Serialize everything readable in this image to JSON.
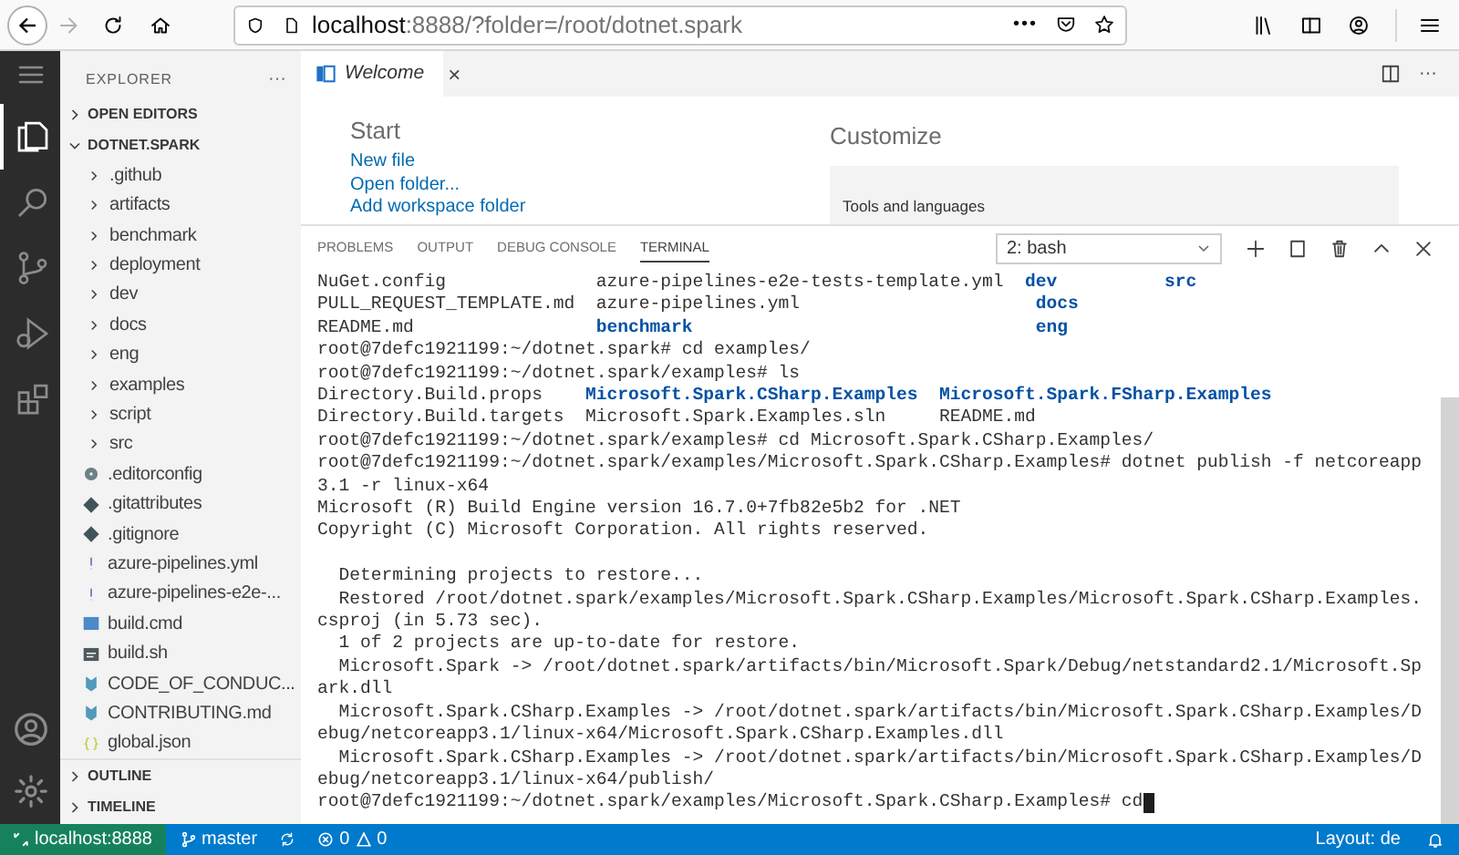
{
  "browser": {
    "url_host": "localhost",
    "url_path": ":8888/?folder=/root/dotnet.spark",
    "more": "•••",
    "forward_disabled": true
  },
  "activity_bar": [
    {
      "selected": true
    },
    {
      "selected": false
    },
    {
      "selected": false
    },
    {
      "selected": false
    },
    {
      "selected": false
    }
  ],
  "sidebar": {
    "title": "EXPLORER",
    "more": "···",
    "sections": [
      {
        "label": "OPEN EDITORS",
        "expanded": false
      },
      {
        "label": "DOTNET.SPARK",
        "expanded": true
      }
    ],
    "items": [
      {
        "kind": "folder",
        "label": ".github"
      },
      {
        "kind": "folder",
        "label": "artifacts"
      },
      {
        "kind": "folder",
        "label": "benchmark"
      },
      {
        "kind": "folder",
        "label": "deployment"
      },
      {
        "kind": "folder",
        "label": "dev"
      },
      {
        "kind": "folder",
        "label": "docs"
      },
      {
        "kind": "folder",
        "label": "eng"
      },
      {
        "kind": "folder",
        "label": "examples"
      },
      {
        "kind": "folder",
        "label": "script"
      },
      {
        "kind": "folder",
        "label": "src"
      },
      {
        "kind": "config",
        "label": ".editorconfig"
      },
      {
        "kind": "git",
        "label": ".gitattributes"
      },
      {
        "kind": "git",
        "label": ".gitignore"
      },
      {
        "kind": "yaml",
        "label": "azure-pipelines.yml"
      },
      {
        "kind": "yaml",
        "label": "azure-pipelines-e2e-..."
      },
      {
        "kind": "cmd",
        "label": "build.cmd"
      },
      {
        "kind": "shell",
        "label": "build.sh"
      },
      {
        "kind": "markdown",
        "label": "CODE_OF_CONDUC..."
      },
      {
        "kind": "markdown",
        "label": "CONTRIBUTING.md"
      },
      {
        "kind": "json",
        "label": "global.json"
      }
    ],
    "bottom_sections": [
      {
        "label": "OUTLINE",
        "expanded": false
      },
      {
        "label": "TIMELINE",
        "expanded": false
      }
    ]
  },
  "editor": {
    "tabs": [
      {
        "label": "Welcome",
        "selected": true,
        "close": "×"
      }
    ],
    "more": "···",
    "welcome": {
      "start_title": "Start",
      "start_links": [
        "New file",
        "Open folder...",
        "Add workspace folder"
      ],
      "customize_title": "Customize",
      "card_title": "Tools and languages"
    }
  },
  "panel": {
    "tabs": [
      {
        "label": "PROBLEMS",
        "selected": false
      },
      {
        "label": "OUTPUT",
        "selected": false
      },
      {
        "label": "DEBUG CONSOLE",
        "selected": false
      },
      {
        "label": "TERMINAL",
        "selected": true
      }
    ],
    "terminal_select": "2: bash",
    "lines": [
      {
        "kind": "text",
        "segments": [
          {
            "text": "NuGet.config              azure-pipelines-e2e-tests-template.yml  ",
            "dir": false
          },
          {
            "text": "dev          ",
            "dir": true
          },
          {
            "text": "src",
            "dir": true
          }
        ]
      },
      {
        "kind": "text",
        "segments": [
          {
            "text": "PULL_REQUEST_TEMPLATE.md  azure-pipelines.yml                      ",
            "dir": false
          },
          {
            "text": "docs",
            "dir": true
          }
        ]
      },
      {
        "kind": "text",
        "segments": [
          {
            "text": "README.md                 ",
            "dir": false
          },
          {
            "text": "benchmark                                ",
            "dir": true
          },
          {
            "text": "eng",
            "dir": true
          }
        ]
      },
      {
        "kind": "text",
        "segments": [
          {
            "text": "root@7defc1921199:~/dotnet.spark# cd examples/",
            "dir": false
          }
        ]
      },
      {
        "kind": "text",
        "segments": [
          {
            "text": "root@7defc1921199:~/dotnet.spark/examples# ls",
            "dir": false
          }
        ]
      },
      {
        "kind": "text",
        "segments": [
          {
            "text": "Directory.Build.props    ",
            "dir": false
          },
          {
            "text": "Microsoft.Spark.CSharp.Examples  ",
            "dir": true
          },
          {
            "text": "Microsoft.Spark.FSharp.Examples",
            "dir": true
          }
        ]
      },
      {
        "kind": "text",
        "segments": [
          {
            "text": "Directory.Build.targets  Microsoft.Spark.Examples.sln     README.md",
            "dir": false
          }
        ]
      },
      {
        "kind": "text",
        "segments": [
          {
            "text": "root@7defc1921199:~/dotnet.spark/examples# cd Microsoft.Spark.CSharp.Examples/",
            "dir": false
          }
        ]
      },
      {
        "kind": "text",
        "segments": [
          {
            "text": "root@7defc1921199:~/dotnet.spark/examples/Microsoft.Spark.CSharp.Examples# dotnet publish -f netcoreapp",
            "dir": false
          }
        ]
      },
      {
        "kind": "text",
        "segments": [
          {
            "text": "3.1 -r linux-x64",
            "dir": false
          }
        ]
      },
      {
        "kind": "text",
        "segments": [
          {
            "text": "Microsoft (R) Build Engine version 16.7.0+7fb82e5b2 for .NET",
            "dir": false
          }
        ]
      },
      {
        "kind": "text",
        "segments": [
          {
            "text": "Copyright (C) Microsoft Corporation. All rights reserved.",
            "dir": false
          }
        ]
      },
      {
        "kind": "blank"
      },
      {
        "kind": "text",
        "segments": [
          {
            "text": "  Determining projects to restore...",
            "dir": false
          }
        ]
      },
      {
        "kind": "text",
        "segments": [
          {
            "text": "  Restored /root/dotnet.spark/examples/Microsoft.Spark.CSharp.Examples/Microsoft.Spark.CSharp.Examples.",
            "dir": false
          }
        ]
      },
      {
        "kind": "text",
        "segments": [
          {
            "text": "csproj (in 5.73 sec).",
            "dir": false
          }
        ]
      },
      {
        "kind": "text",
        "segments": [
          {
            "text": "  1 of 2 projects are up-to-date for restore.",
            "dir": false
          }
        ]
      },
      {
        "kind": "text",
        "segments": [
          {
            "text": "  Microsoft.Spark -> /root/dotnet.spark/artifacts/bin/Microsoft.Spark/Debug/netstandard2.1/Microsoft.Sp",
            "dir": false
          }
        ]
      },
      {
        "kind": "text",
        "segments": [
          {
            "text": "ark.dll",
            "dir": false
          }
        ]
      },
      {
        "kind": "text",
        "segments": [
          {
            "text": "  Microsoft.Spark.CSharp.Examples -> /root/dotnet.spark/artifacts/bin/Microsoft.Spark.CSharp.Examples/D",
            "dir": false
          }
        ]
      },
      {
        "kind": "text",
        "segments": [
          {
            "text": "ebug/netcoreapp3.1/linux-x64/Microsoft.Spark.CSharp.Examples.dll",
            "dir": false
          }
        ]
      },
      {
        "kind": "text",
        "segments": [
          {
            "text": "  Microsoft.Spark.CSharp.Examples -> /root/dotnet.spark/artifacts/bin/Microsoft.Spark.CSharp.Examples/D",
            "dir": false
          }
        ]
      },
      {
        "kind": "text",
        "segments": [
          {
            "text": "ebug/netcoreapp3.1/linux-x64/publish/",
            "dir": false
          }
        ]
      },
      {
        "kind": "prompt",
        "segments": [
          {
            "text": "root@7defc1921199:~/dotnet.spark/examples/Microsoft.Spark.CSharp.Examples# cd",
            "dir": false
          }
        ]
      }
    ]
  },
  "status_bar": {
    "remote": "localhost:8888",
    "branch": "master",
    "errors": "0",
    "warnings": "0",
    "layout": "Layout: de"
  }
}
